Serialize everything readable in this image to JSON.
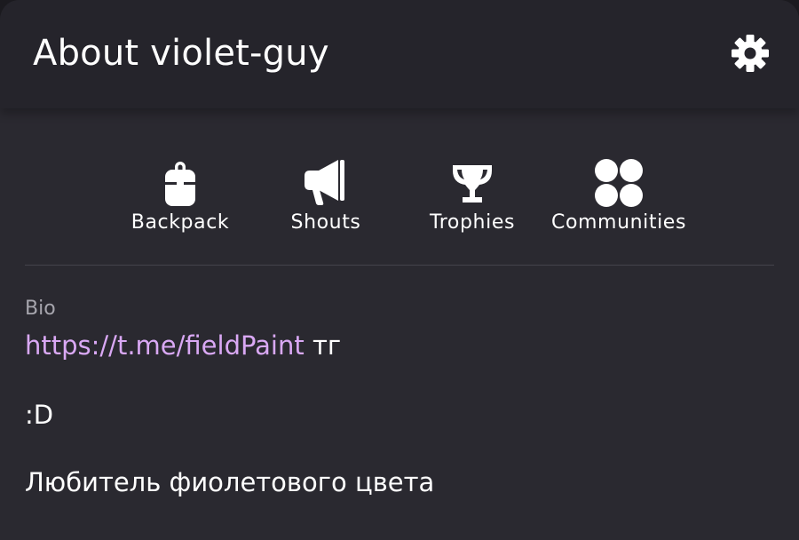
{
  "header": {
    "title": "About violet-guy",
    "settings_icon": "gear-icon"
  },
  "actions": [
    {
      "label": "Backpack",
      "icon": "backpack-icon"
    },
    {
      "label": "Shouts",
      "icon": "megaphone-icon"
    },
    {
      "label": "Trophies",
      "icon": "trophy-icon"
    },
    {
      "label": "Communities",
      "icon": "four-circles-icon"
    }
  ],
  "bio": {
    "label": "Bio",
    "link_text": "https://t.me/fieldPaint",
    "link_suffix": " тг",
    "line2": ":D",
    "line3": "Любитель фиолетового цвета"
  },
  "colors": {
    "background": "#2a2930",
    "header": "#25242b",
    "link": "#d9a8f4",
    "muted_text": "#a6a5ad",
    "text": "#ffffff"
  }
}
